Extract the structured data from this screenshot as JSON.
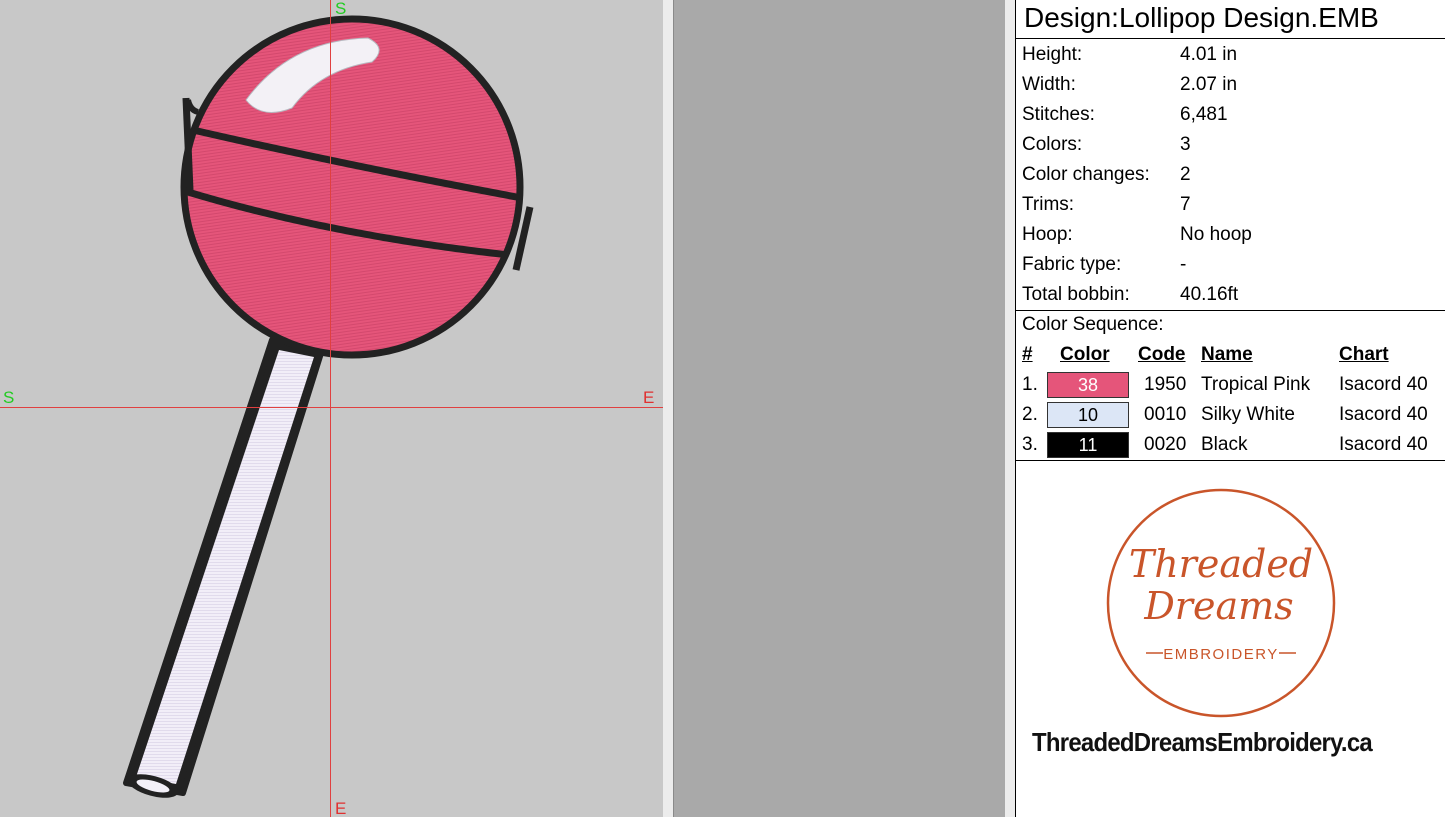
{
  "canvas": {
    "axis_labels": {
      "top": "S",
      "bottom": "E",
      "left": "S",
      "right": "E"
    },
    "colors": {
      "background": "#c8c8c8",
      "axis": "#e04040"
    }
  },
  "panel": {
    "title": "Design:Lollipop Design.EMB",
    "properties": [
      {
        "label": "Height:",
        "value": "4.01 in"
      },
      {
        "label": "Width:",
        "value": "2.07 in"
      },
      {
        "label": "Stitches:",
        "value": "6,481"
      },
      {
        "label": "Colors:",
        "value": "3"
      },
      {
        "label": "Color changes:",
        "value": "2"
      },
      {
        "label": "Trims:",
        "value": "7"
      },
      {
        "label": "Hoop:",
        "value": "No hoop"
      },
      {
        "label": "Fabric type:",
        "value": "-"
      },
      {
        "label": "Total bobbin:",
        "value": "40.16ft"
      }
    ],
    "color_sequence_label": "Color Sequence:",
    "headers": {
      "num": "#",
      "color": "Color",
      "code": "Code",
      "name": "Name",
      "chart": "Chart"
    },
    "colors": [
      {
        "num": "1.",
        "swatch": "38",
        "hex": "#e5557a",
        "text_color": "#ffffff",
        "code": "1950",
        "name": "Tropical Pink",
        "chart": "Isacord 40"
      },
      {
        "num": "2.",
        "swatch": "10",
        "hex": "#dce6f6",
        "text_color": "#000000",
        "code": "0010",
        "name": "Silky White",
        "chart": "Isacord 40"
      },
      {
        "num": "3.",
        "swatch": "11",
        "hex": "#000000",
        "text_color": "#ffffff",
        "code": "0020",
        "name": "Black",
        "chart": "Isacord 40"
      }
    ],
    "logo": {
      "line1": "Threaded",
      "line2": "Dreams",
      "line3": "EMBROIDERY",
      "color": "#c9552a"
    },
    "website": "ThreadedDreamsEmbroidery.ca"
  }
}
